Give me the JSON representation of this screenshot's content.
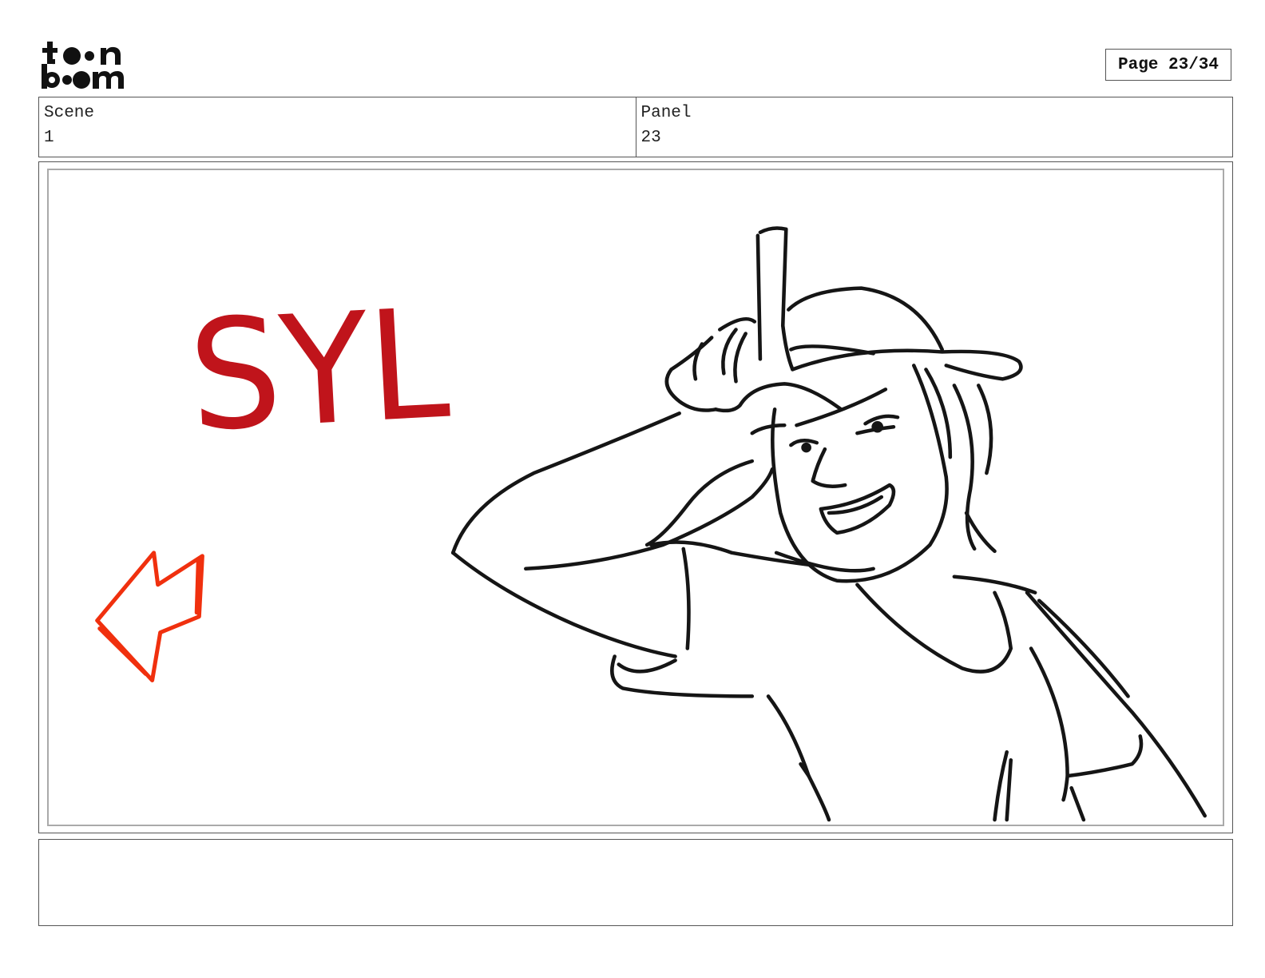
{
  "header": {
    "logo_text": "toon boom",
    "page_counter": "Page 23/34"
  },
  "info": {
    "scene_label": "Scene",
    "scene_value": "1",
    "panel_label": "Panel",
    "panel_value": "23"
  },
  "panel": {
    "drawing_text": "SYL",
    "colors": {
      "text_red": "#c0141b",
      "arrow_orange": "#f0300e",
      "line_black": "#151515"
    }
  },
  "notes": {
    "text": ""
  }
}
